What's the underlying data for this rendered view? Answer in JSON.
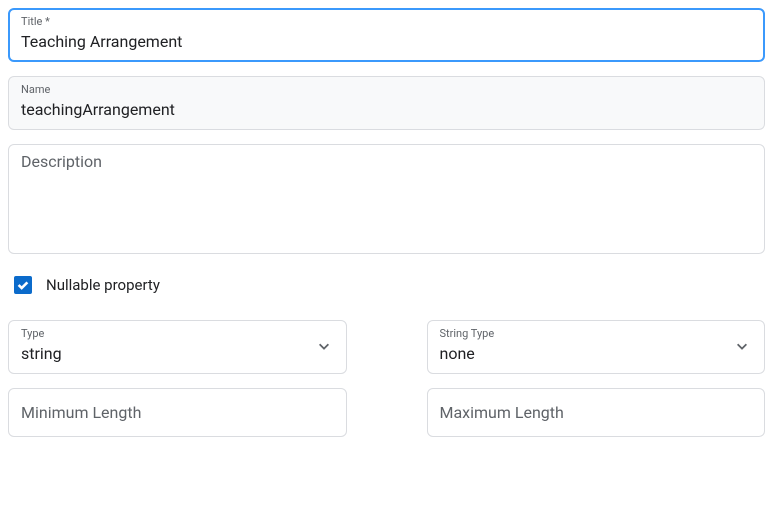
{
  "title": {
    "label": "Title *",
    "value": "Teaching Arrangement"
  },
  "name": {
    "label": "Name",
    "value": "teachingArrangement"
  },
  "description": {
    "placeholder": "Description",
    "value": ""
  },
  "nullable": {
    "label": "Nullable property",
    "checked": true
  },
  "type": {
    "label": "Type",
    "value": "string"
  },
  "stringType": {
    "label": "String Type",
    "value": "none"
  },
  "minLength": {
    "placeholder": "Minimum Length",
    "value": ""
  },
  "maxLength": {
    "placeholder": "Maximum Length",
    "value": ""
  }
}
